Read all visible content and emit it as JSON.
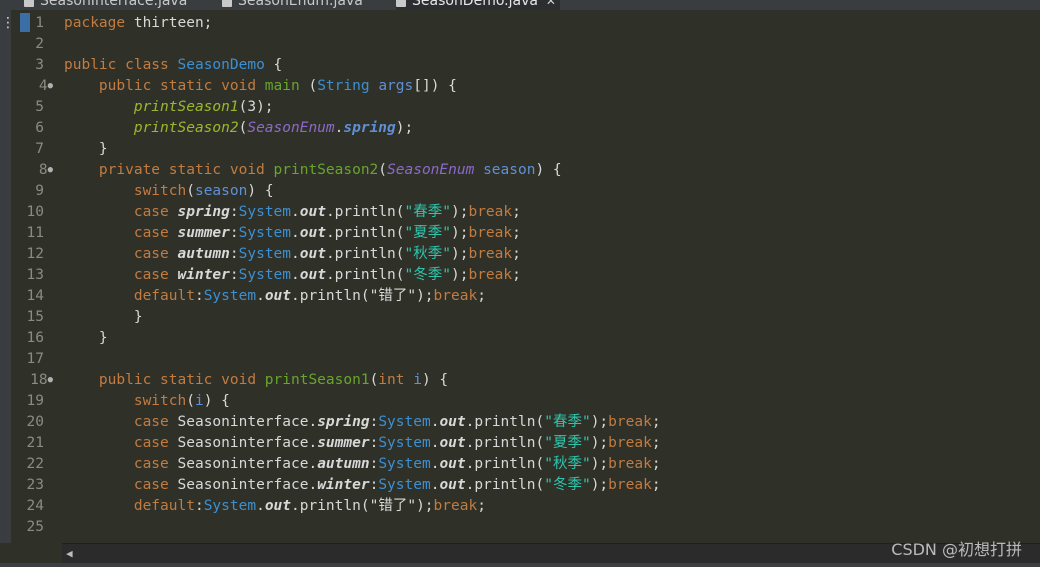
{
  "tabs": [
    {
      "label": "SeasonInterface.java"
    },
    {
      "label": "SeasonEnum.java"
    },
    {
      "label": "SeasonDemo.java"
    }
  ],
  "left_menu_icon": "vertical-ellipsis-icon",
  "close_icon": "close-icon",
  "colors": {
    "keyword": "#c27b40",
    "type": "#3d8fd1",
    "method": "#68a52c",
    "static_method": "#9cb82a",
    "enum": "#8c69c9",
    "field": "#5f8fd6",
    "string": "#2fc4ab",
    "plain": "#d8d8d8"
  },
  "lines": [
    {
      "n": "1",
      "fold": false,
      "tokens": [
        [
          "package",
          "keyword"
        ],
        [
          " thirteen;",
          "plain"
        ]
      ]
    },
    {
      "n": "2",
      "fold": false,
      "tokens": []
    },
    {
      "n": "3",
      "fold": false,
      "tokens": [
        [
          "public class ",
          "keyword"
        ],
        [
          "SeasonDemo",
          "type"
        ],
        [
          " {",
          "plain"
        ]
      ]
    },
    {
      "n": "4",
      "fold": true,
      "tokens": [
        [
          "    ",
          "plain"
        ],
        [
          "public static void ",
          "keyword"
        ],
        [
          "main",
          "method"
        ],
        [
          " (",
          "plain"
        ],
        [
          "String",
          "type"
        ],
        [
          " ",
          "plain"
        ],
        [
          "args",
          "field"
        ],
        [
          "[]) {",
          "plain"
        ]
      ]
    },
    {
      "n": "5",
      "fold": false,
      "tokens": [
        [
          "        ",
          "plain"
        ],
        [
          "printSeason1",
          "static_method_i"
        ],
        [
          "(3);",
          "plain"
        ]
      ]
    },
    {
      "n": "6",
      "fold": false,
      "tokens": [
        [
          "        ",
          "plain"
        ],
        [
          "printSeason2",
          "static_method_i"
        ],
        [
          "(",
          "plain"
        ],
        [
          "SeasonEnum",
          "enum_i"
        ],
        [
          ".",
          "plain"
        ],
        [
          "spring",
          "field_bi"
        ],
        [
          ");",
          "plain"
        ]
      ]
    },
    {
      "n": "7",
      "fold": false,
      "tokens": [
        [
          "    }",
          "plain"
        ]
      ]
    },
    {
      "n": "8",
      "fold": true,
      "tokens": [
        [
          "    ",
          "plain"
        ],
        [
          "private static void ",
          "keyword"
        ],
        [
          "printSeason2",
          "method"
        ],
        [
          "(",
          "plain"
        ],
        [
          "SeasonEnum",
          "enum_i"
        ],
        [
          " ",
          "plain"
        ],
        [
          "season",
          "field"
        ],
        [
          ") {",
          "plain"
        ]
      ]
    },
    {
      "n": "9",
      "fold": false,
      "tokens": [
        [
          "        ",
          "plain"
        ],
        [
          "switch",
          "keyword"
        ],
        [
          "(",
          "plain"
        ],
        [
          "season",
          "field"
        ],
        [
          ") {",
          "plain"
        ]
      ]
    },
    {
      "n": "10",
      "fold": false,
      "tokens": [
        [
          "        ",
          "plain"
        ],
        [
          "case ",
          "keyword"
        ],
        [
          "spring",
          "white_bi"
        ],
        [
          ":",
          "plain"
        ],
        [
          "System",
          "type"
        ],
        [
          ".",
          "plain"
        ],
        [
          "out",
          "white_bi"
        ],
        [
          ".println(",
          "plain"
        ],
        [
          "\"春季\"",
          "string"
        ],
        [
          ");",
          "plain"
        ],
        [
          "break",
          "keyword"
        ],
        [
          ";",
          "plain"
        ]
      ]
    },
    {
      "n": "11",
      "fold": false,
      "tokens": [
        [
          "        ",
          "plain"
        ],
        [
          "case ",
          "keyword"
        ],
        [
          "summer",
          "white_bi"
        ],
        [
          ":",
          "plain"
        ],
        [
          "System",
          "type"
        ],
        [
          ".",
          "plain"
        ],
        [
          "out",
          "white_bi"
        ],
        [
          ".println(",
          "plain"
        ],
        [
          "\"夏季\"",
          "string"
        ],
        [
          ");",
          "plain"
        ],
        [
          "break",
          "keyword"
        ],
        [
          ";",
          "plain"
        ]
      ]
    },
    {
      "n": "12",
      "fold": false,
      "tokens": [
        [
          "        ",
          "plain"
        ],
        [
          "case ",
          "keyword"
        ],
        [
          "autumn",
          "white_bi"
        ],
        [
          ":",
          "plain"
        ],
        [
          "System",
          "type"
        ],
        [
          ".",
          "plain"
        ],
        [
          "out",
          "white_bi"
        ],
        [
          ".println(",
          "plain"
        ],
        [
          "\"秋季\"",
          "string"
        ],
        [
          ");",
          "plain"
        ],
        [
          "break",
          "keyword"
        ],
        [
          ";",
          "plain"
        ]
      ]
    },
    {
      "n": "13",
      "fold": false,
      "tokens": [
        [
          "        ",
          "plain"
        ],
        [
          "case ",
          "keyword"
        ],
        [
          "winter",
          "white_bi"
        ],
        [
          ":",
          "plain"
        ],
        [
          "System",
          "type"
        ],
        [
          ".",
          "plain"
        ],
        [
          "out",
          "white_bi"
        ],
        [
          ".println(",
          "plain"
        ],
        [
          "\"冬季\"",
          "string"
        ],
        [
          ");",
          "plain"
        ],
        [
          "break",
          "keyword"
        ],
        [
          ";",
          "plain"
        ]
      ]
    },
    {
      "n": "14",
      "fold": false,
      "tokens": [
        [
          "        ",
          "plain"
        ],
        [
          "default",
          "keyword"
        ],
        [
          ":",
          "plain"
        ],
        [
          "System",
          "type"
        ],
        [
          ".",
          "plain"
        ],
        [
          "out",
          "white_bi"
        ],
        [
          ".println(",
          "plain"
        ],
        [
          "\"错了\"",
          "plain"
        ],
        [
          ");",
          "plain"
        ],
        [
          "break",
          "keyword"
        ],
        [
          ";",
          "plain"
        ]
      ]
    },
    {
      "n": "15",
      "fold": false,
      "tokens": [
        [
          "        }",
          "plain"
        ]
      ]
    },
    {
      "n": "16",
      "fold": false,
      "tokens": [
        [
          "    }",
          "plain"
        ]
      ]
    },
    {
      "n": "17",
      "fold": false,
      "tokens": []
    },
    {
      "n": "18",
      "fold": true,
      "tokens": [
        [
          "    ",
          "plain"
        ],
        [
          "public static void ",
          "keyword"
        ],
        [
          "printSeason1",
          "method"
        ],
        [
          "(",
          "plain"
        ],
        [
          "int",
          "keyword"
        ],
        [
          " ",
          "plain"
        ],
        [
          "i",
          "field"
        ],
        [
          ") {",
          "plain"
        ]
      ]
    },
    {
      "n": "19",
      "fold": false,
      "tokens": [
        [
          "        ",
          "plain"
        ],
        [
          "switch",
          "keyword"
        ],
        [
          "(",
          "plain"
        ],
        [
          "i",
          "field"
        ],
        [
          ") {",
          "plain"
        ]
      ]
    },
    {
      "n": "20",
      "fold": false,
      "tokens": [
        [
          "        ",
          "plain"
        ],
        [
          "case ",
          "keyword"
        ],
        [
          "Seasoninterface.",
          "plain"
        ],
        [
          "spring",
          "white_bi"
        ],
        [
          ":",
          "plain"
        ],
        [
          "System",
          "type"
        ],
        [
          ".",
          "plain"
        ],
        [
          "out",
          "white_bi"
        ],
        [
          ".println(",
          "plain"
        ],
        [
          "\"春季\"",
          "string"
        ],
        [
          ");",
          "plain"
        ],
        [
          "break",
          "keyword"
        ],
        [
          ";",
          "plain"
        ]
      ]
    },
    {
      "n": "21",
      "fold": false,
      "tokens": [
        [
          "        ",
          "plain"
        ],
        [
          "case ",
          "keyword"
        ],
        [
          "Seasoninterface.",
          "plain"
        ],
        [
          "summer",
          "white_bi"
        ],
        [
          ":",
          "plain"
        ],
        [
          "System",
          "type"
        ],
        [
          ".",
          "plain"
        ],
        [
          "out",
          "white_bi"
        ],
        [
          ".println(",
          "plain"
        ],
        [
          "\"夏季\"",
          "string"
        ],
        [
          ");",
          "plain"
        ],
        [
          "break",
          "keyword"
        ],
        [
          ";",
          "plain"
        ]
      ]
    },
    {
      "n": "22",
      "fold": false,
      "tokens": [
        [
          "        ",
          "plain"
        ],
        [
          "case ",
          "keyword"
        ],
        [
          "Seasoninterface.",
          "plain"
        ],
        [
          "autumn",
          "white_bi"
        ],
        [
          ":",
          "plain"
        ],
        [
          "System",
          "type"
        ],
        [
          ".",
          "plain"
        ],
        [
          "out",
          "white_bi"
        ],
        [
          ".println(",
          "plain"
        ],
        [
          "\"秋季\"",
          "string"
        ],
        [
          ");",
          "plain"
        ],
        [
          "break",
          "keyword"
        ],
        [
          ";",
          "plain"
        ]
      ]
    },
    {
      "n": "23",
      "fold": false,
      "tokens": [
        [
          "        ",
          "plain"
        ],
        [
          "case ",
          "keyword"
        ],
        [
          "Seasoninterface.",
          "plain"
        ],
        [
          "winter",
          "white_bi"
        ],
        [
          ":",
          "plain"
        ],
        [
          "System",
          "type"
        ],
        [
          ".",
          "plain"
        ],
        [
          "out",
          "white_bi"
        ],
        [
          ".println(",
          "plain"
        ],
        [
          "\"冬季\"",
          "string"
        ],
        [
          ");",
          "plain"
        ],
        [
          "break",
          "keyword"
        ],
        [
          ";",
          "plain"
        ]
      ]
    },
    {
      "n": "24",
      "fold": false,
      "tokens": [
        [
          "        ",
          "plain"
        ],
        [
          "default",
          "keyword"
        ],
        [
          ":",
          "plain"
        ],
        [
          "System",
          "type"
        ],
        [
          ".",
          "plain"
        ],
        [
          "out",
          "white_bi"
        ],
        [
          ".println(",
          "plain"
        ],
        [
          "\"错了\"",
          "plain"
        ],
        [
          ");",
          "plain"
        ],
        [
          "break",
          "keyword"
        ],
        [
          ";",
          "plain"
        ]
      ]
    },
    {
      "n": "25",
      "fold": false,
      "tokens": []
    }
  ],
  "watermark": "CSDN @初想打拼"
}
